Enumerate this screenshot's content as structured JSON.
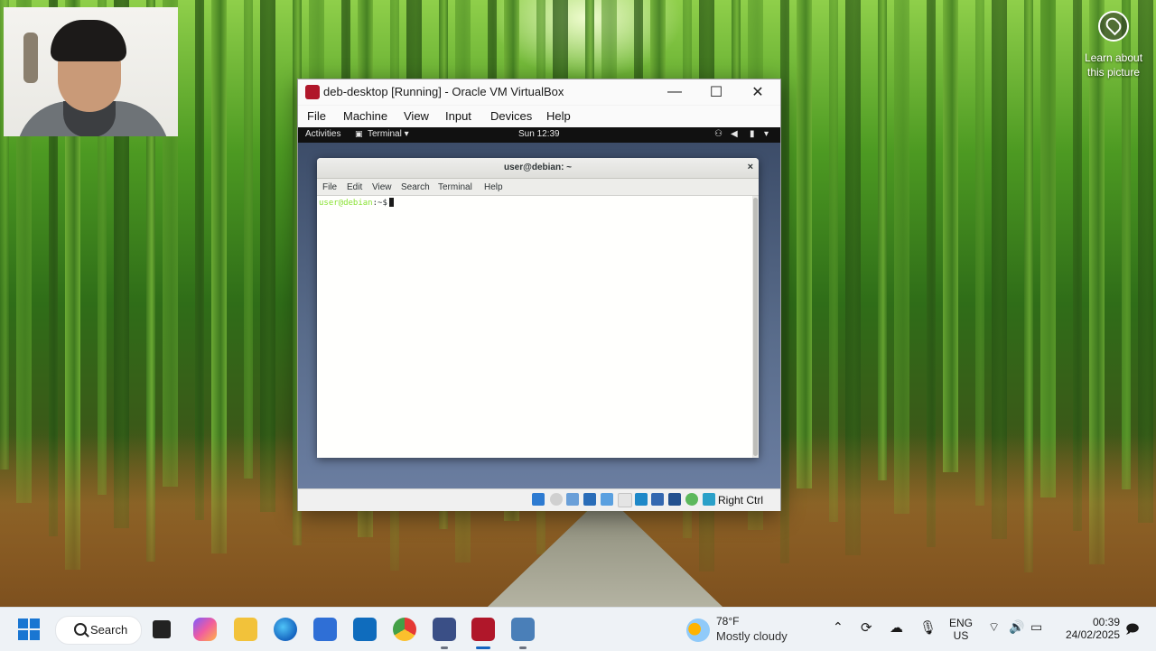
{
  "webcam": {
    "visible": true
  },
  "desktop": {
    "learn_about_picture": "Learn about this picture"
  },
  "vbox": {
    "title": "deb-desktop [Running] - Oracle VM VirtualBox",
    "menu": [
      "File",
      "Machine",
      "View",
      "Input",
      "Devices",
      "Help"
    ],
    "window_buttons": {
      "minimize": "—",
      "maximize": "☐",
      "close": "✕"
    },
    "host_key": "Right Ctrl",
    "status_icons": [
      "hard-disk-icon",
      "optical-drive-icon",
      "audio-icon",
      "network-icon",
      "usb-icon",
      "shared-folder-icon",
      "display-icon",
      "video-capture-icon",
      "cpu-icon",
      "guest-additions-icon",
      "mouse-integration-icon"
    ]
  },
  "guest": {
    "activities": "Activities",
    "app_menu": "Terminal ▾",
    "clock": "Sun 12:39",
    "terminal": {
      "title": "user@debian: ~",
      "close": "×",
      "menu": [
        "File",
        "Edit",
        "View",
        "Search",
        "Terminal",
        "Help"
      ],
      "prompt_user": "user@debian",
      "prompt_path": ":~$"
    }
  },
  "taskbar": {
    "search_label": "Search",
    "weather_temp": "78°F",
    "weather_condition": "Mostly cloudy",
    "lang_line1": "ENG",
    "lang_line2": "US",
    "time": "00:39",
    "date": "24/02/2025"
  },
  "colors": {
    "prompt_green": "#8ae234",
    "taskbar_bg": "#eef2f6",
    "vbox_accent": "#b0172a",
    "gnome_topbar": "#111111"
  }
}
